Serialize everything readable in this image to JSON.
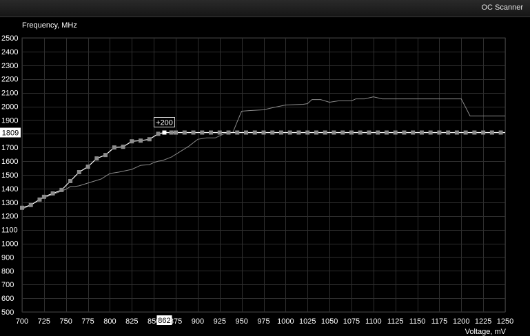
{
  "window": {
    "title": "OC Scanner"
  },
  "chart_data": {
    "type": "line",
    "ylabel": "Frequency, MHz",
    "xlabel": "Voltage, mV",
    "xlim": [
      700,
      1250
    ],
    "ylim": [
      500,
      2500
    ],
    "x_ticks": [
      700,
      725,
      750,
      775,
      800,
      825,
      850,
      875,
      900,
      925,
      950,
      975,
      1000,
      1025,
      1050,
      1075,
      1100,
      1125,
      1150,
      1175,
      1200,
      1225,
      1250
    ],
    "y_ticks": [
      500,
      600,
      700,
      800,
      900,
      1000,
      1100,
      1200,
      1300,
      1400,
      1500,
      1600,
      1700,
      1800,
      1900,
      2000,
      2100,
      2200,
      2300,
      2400,
      2500
    ],
    "grid": true,
    "locked_frequency": "1809",
    "locked_voltage": "862",
    "offset_label": "+200",
    "series": [
      {
        "points": [
          [
            700,
            1250
          ],
          [
            710,
            1280
          ],
          [
            720,
            1320
          ],
          [
            730,
            1345
          ],
          [
            740,
            1370
          ],
          [
            750,
            1395
          ],
          [
            755,
            1415
          ],
          [
            760,
            1415
          ],
          [
            765,
            1420
          ],
          [
            775,
            1440
          ],
          [
            790,
            1470
          ],
          [
            800,
            1510
          ],
          [
            810,
            1520
          ],
          [
            825,
            1540
          ],
          [
            835,
            1570
          ],
          [
            845,
            1575
          ],
          [
            850,
            1590
          ],
          [
            855,
            1600
          ],
          [
            860,
            1605
          ],
          [
            870,
            1630
          ],
          [
            880,
            1670
          ],
          [
            890,
            1710
          ],
          [
            900,
            1760
          ],
          [
            910,
            1770
          ],
          [
            920,
            1770
          ],
          [
            930,
            1800
          ],
          [
            940,
            1810
          ],
          [
            945,
            1890
          ],
          [
            950,
            1965
          ],
          [
            960,
            1970
          ],
          [
            975,
            1975
          ],
          [
            985,
            1990
          ],
          [
            1000,
            2010
          ],
          [
            1020,
            2015
          ],
          [
            1025,
            2020
          ],
          [
            1030,
            2050
          ],
          [
            1040,
            2050
          ],
          [
            1050,
            2030
          ],
          [
            1060,
            2040
          ],
          [
            1075,
            2040
          ],
          [
            1080,
            2055
          ],
          [
            1090,
            2055
          ],
          [
            1100,
            2070
          ],
          [
            1110,
            2055
          ],
          [
            1200,
            2055
          ],
          [
            1210,
            1930
          ],
          [
            1250,
            1930
          ]
        ]
      },
      {
        "points": [
          [
            700,
            1260
          ],
          [
            710,
            1280
          ],
          [
            720,
            1320
          ],
          [
            725,
            1340
          ],
          [
            735,
            1365
          ],
          [
            745,
            1390
          ],
          [
            755,
            1455
          ],
          [
            765,
            1520
          ],
          [
            775,
            1560
          ],
          [
            785,
            1620
          ],
          [
            795,
            1645
          ],
          [
            805,
            1700
          ],
          [
            815,
            1705
          ],
          [
            825,
            1745
          ],
          [
            835,
            1750
          ],
          [
            845,
            1760
          ],
          [
            855,
            1800
          ],
          [
            862,
            1809
          ],
          [
            1250,
            1809
          ]
        ],
        "markers": [
          700,
          710,
          720,
          725,
          735,
          745,
          755,
          765,
          775,
          785,
          795,
          805,
          815,
          825,
          835,
          845,
          855,
          862,
          870,
          875,
          885,
          895,
          905,
          915,
          925,
          935,
          945,
          955,
          965,
          975,
          985,
          995,
          1005,
          1015,
          1025,
          1035,
          1045,
          1055,
          1065,
          1075,
          1085,
          1095,
          1105,
          1115,
          1125,
          1135,
          1145,
          1155,
          1165,
          1175,
          1185,
          1195,
          1205,
          1215,
          1225,
          1235,
          1245
        ]
      }
    ]
  }
}
